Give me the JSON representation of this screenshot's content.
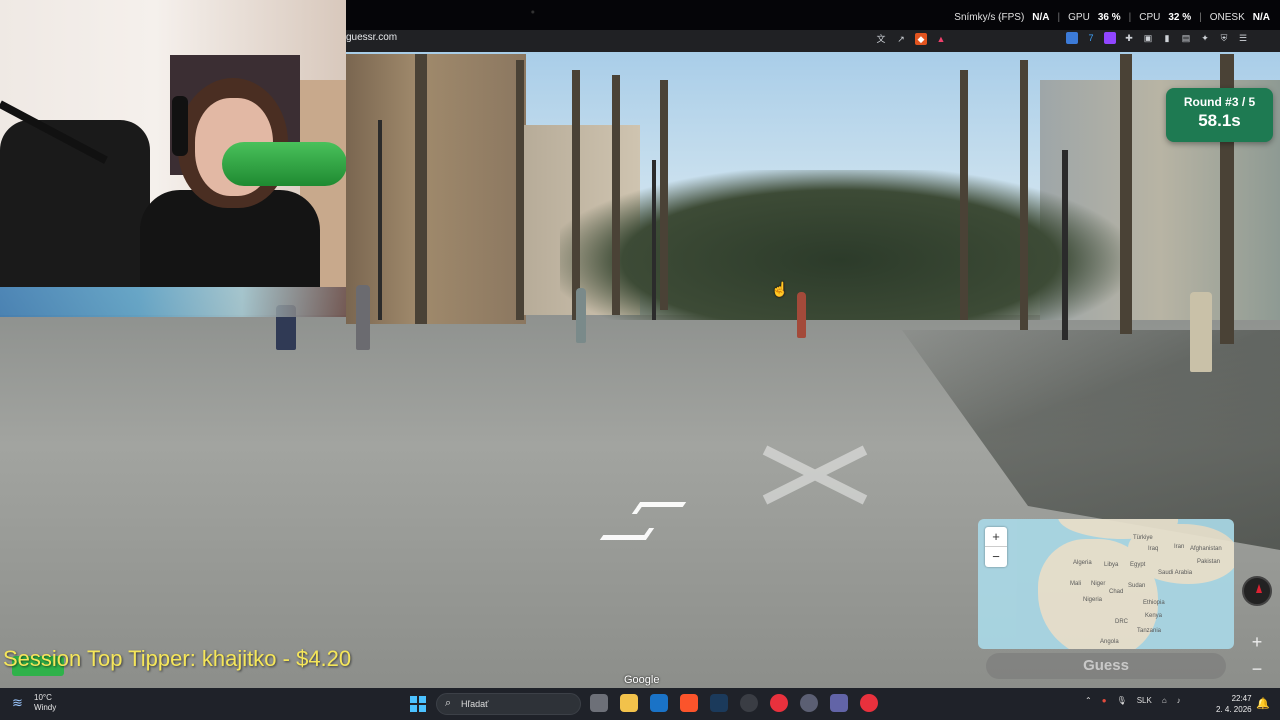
{
  "browser": {
    "url": "guessr.com",
    "url_icons": [
      "translate-icon",
      "share-icon",
      "brave-shield-icon",
      "brave-rewards-icon"
    ],
    "extension_icons": [
      "extension-blue-icon",
      "extension-7tv-icon",
      "extension-twitch-icon",
      "puzzle-icon",
      "window-icon",
      "sidebar-icon",
      "wallet-icon",
      "magic-icon",
      "vpn-icon",
      "menu-icon"
    ]
  },
  "overlay_stats": {
    "fps_label": "Snímky/s (FPS)",
    "fps_value": "N/A",
    "gpu_label": "GPU",
    "gpu_value": "36 %",
    "cpu_label": "CPU",
    "cpu_value": "32 %",
    "latency_label": "ONESK",
    "latency_value": "N/A"
  },
  "game": {
    "round_label": "Round #3 / 5",
    "timer": "58.1s",
    "guess_button": "Guess",
    "map_zoom_in": "+",
    "map_zoom_out": "−",
    "view_zoom_in": "+",
    "view_zoom_out": "−",
    "watermark": "Google",
    "map_labels": {
      "turkiye": "Türkiye",
      "iraq": "Iraq",
      "iran": "Iran",
      "afghanistan": "Afghanistan",
      "algeria": "Algeria",
      "libya": "Libya",
      "egypt": "Egypt",
      "saudi": "Saudi Arabia",
      "pakistan": "Pakistan",
      "mali": "Mali",
      "niger": "Niger",
      "chad": "Chad",
      "sudan": "Sudan",
      "nigeria": "Nigeria",
      "ethiopia": "Ethiopia",
      "kenya": "Kenya",
      "drc": "DRC",
      "tanzania": "Tanzania",
      "angola": "Angola"
    }
  },
  "stream": {
    "tipper_text": "Session Top Tipper: khajitko - $4.20"
  },
  "taskbar": {
    "weather_temp": "10°C",
    "weather_desc": "Windy",
    "search_placeholder": "Hľadať",
    "language": "SLK",
    "time": "22:47",
    "date": "2. 4. 2026"
  },
  "colors": {
    "round_card": "#1e7a52",
    "tipper_text": "#f5e65a",
    "taskbar": "#1f2229"
  }
}
